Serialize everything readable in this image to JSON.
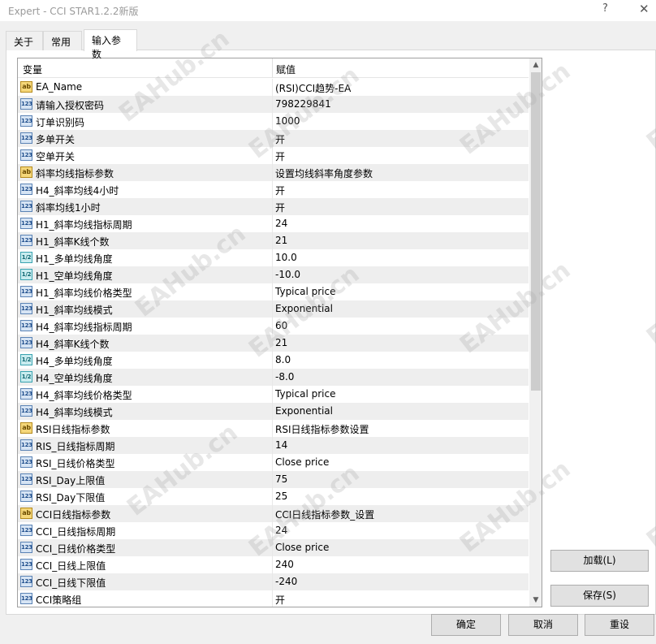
{
  "window": {
    "title": "Expert - CCI STAR1.2.2新版",
    "help": "?",
    "close": "✕"
  },
  "tabs": [
    {
      "label": "关于"
    },
    {
      "label": "常用"
    },
    {
      "label": "输入参数"
    }
  ],
  "grid": {
    "headers": {
      "variable": "变量",
      "value": "赋值"
    },
    "rows": [
      {
        "type": "str",
        "name": "EA_Name",
        "value": " (RSI)CCI趋势-EA"
      },
      {
        "type": "int",
        "name": "请输入授权密码",
        "value": "798229841"
      },
      {
        "type": "int",
        "name": "订单识别码",
        "value": "1000"
      },
      {
        "type": "int",
        "name": "多单开关",
        "value": "开"
      },
      {
        "type": "int",
        "name": "空单开关",
        "value": "开"
      },
      {
        "type": "str",
        "name": "斜率均线指标参数",
        "value": "设置均线斜率角度参数"
      },
      {
        "type": "int",
        "name": "H4_斜率均线4小时",
        "value": "开"
      },
      {
        "type": "int",
        "name": "斜率均线1小时",
        "value": "开"
      },
      {
        "type": "int",
        "name": "H1_斜率均线指标周期",
        "value": "24"
      },
      {
        "type": "int",
        "name": "H1_斜率K线个数",
        "value": "21"
      },
      {
        "type": "dbl",
        "name": "H1_多单均线角度",
        "value": "10.0"
      },
      {
        "type": "dbl",
        "name": "H1_空单均线角度",
        "value": "-10.0"
      },
      {
        "type": "int",
        "name": "H1_斜率均线价格类型",
        "value": "Typical price"
      },
      {
        "type": "int",
        "name": "H1_斜率均线模式",
        "value": "Exponential"
      },
      {
        "type": "int",
        "name": "H4_斜率均线指标周期",
        "value": "60"
      },
      {
        "type": "int",
        "name": "H4_斜率K线个数",
        "value": "21"
      },
      {
        "type": "dbl",
        "name": "H4_多单均线角度",
        "value": "8.0"
      },
      {
        "type": "dbl",
        "name": "H4_空单均线角度",
        "value": "-8.0"
      },
      {
        "type": "int",
        "name": "H4_斜率均线价格类型",
        "value": "Typical price"
      },
      {
        "type": "int",
        "name": "H4_斜率均线模式",
        "value": "Exponential"
      },
      {
        "type": "str",
        "name": "RSI日线指标参数",
        "value": "RSI日线指标参数设置"
      },
      {
        "type": "int",
        "name": "RIS_日线指标周期",
        "value": "14"
      },
      {
        "type": "int",
        "name": "RSI_日线价格类型",
        "value": "Close price"
      },
      {
        "type": "int",
        "name": "RSI_Day上限值",
        "value": "75"
      },
      {
        "type": "int",
        "name": "RSI_Day下限值",
        "value": "25"
      },
      {
        "type": "str",
        "name": "CCI日线指标参数",
        "value": "CCI日线指标参数_设置"
      },
      {
        "type": "int",
        "name": "CCI_日线指标周期",
        "value": "24"
      },
      {
        "type": "int",
        "name": "CCI_日线价格类型",
        "value": "Close price"
      },
      {
        "type": "int",
        "name": "CCI_日线上限值",
        "value": "240"
      },
      {
        "type": "int",
        "name": "CCI_日线下限值",
        "value": "-240"
      },
      {
        "type": "int",
        "name": "CCI策略组",
        "value": "开"
      }
    ]
  },
  "icons": {
    "int": "123",
    "str": "ab",
    "dbl": "1/2"
  },
  "buttons": {
    "load": "加载(L)",
    "save": "保存(S)",
    "ok": "确定",
    "cancel": "取消",
    "reset": "重设"
  },
  "watermark": "EAHub.cn"
}
